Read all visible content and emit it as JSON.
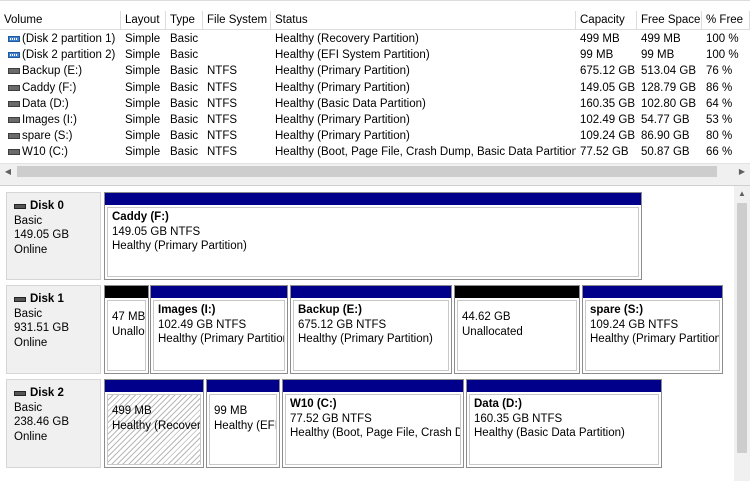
{
  "volume_list": {
    "columns": [
      "Volume",
      "Layout",
      "Type",
      "File System",
      "Status",
      "Capacity",
      "Free Space",
      "% Free"
    ],
    "rows": [
      {
        "volume": "(Disk 2 partition 1)",
        "layout": "Simple",
        "type": "Basic",
        "fs": "",
        "status": "Healthy (Recovery Partition)",
        "capacity": "499 MB",
        "free": "499 MB",
        "pct": "100 %",
        "icon": "hidden-volume-icon"
      },
      {
        "volume": "(Disk 2 partition 2)",
        "layout": "Simple",
        "type": "Basic",
        "fs": "",
        "status": "Healthy (EFI System Partition)",
        "capacity": "99 MB",
        "free": "99 MB",
        "pct": "100 %",
        "icon": "hidden-volume-icon"
      },
      {
        "volume": "Backup (E:)",
        "layout": "Simple",
        "type": "Basic",
        "fs": "NTFS",
        "status": "Healthy (Primary Partition)",
        "capacity": "675.12 GB",
        "free": "513.04 GB",
        "pct": "76 %",
        "icon": "volume-icon"
      },
      {
        "volume": "Caddy (F:)",
        "layout": "Simple",
        "type": "Basic",
        "fs": "NTFS",
        "status": "Healthy (Primary Partition)",
        "capacity": "149.05 GB",
        "free": "128.79 GB",
        "pct": "86 %",
        "icon": "volume-icon"
      },
      {
        "volume": "Data (D:)",
        "layout": "Simple",
        "type": "Basic",
        "fs": "NTFS",
        "status": "Healthy (Basic Data Partition)",
        "capacity": "160.35 GB",
        "free": "102.80 GB",
        "pct": "64 %",
        "icon": "volume-icon"
      },
      {
        "volume": "Images (I:)",
        "layout": "Simple",
        "type": "Basic",
        "fs": "NTFS",
        "status": "Healthy (Primary Partition)",
        "capacity": "102.49 GB",
        "free": "54.77 GB",
        "pct": "53 %",
        "icon": "volume-icon"
      },
      {
        "volume": "spare (S:)",
        "layout": "Simple",
        "type": "Basic",
        "fs": "NTFS",
        "status": "Healthy (Primary Partition)",
        "capacity": "109.24 GB",
        "free": "86.90 GB",
        "pct": "80 %",
        "icon": "volume-icon"
      },
      {
        "volume": "W10 (C:)",
        "layout": "Simple",
        "type": "Basic",
        "fs": "NTFS",
        "status": "Healthy (Boot, Page File, Crash Dump, Basic Data Partition)",
        "capacity": "77.52 GB",
        "free": "50.87 GB",
        "pct": "66 %",
        "icon": "volume-icon"
      }
    ]
  },
  "scroll": {
    "left_arrow": "◀",
    "right_arrow": "▶",
    "up_arrow": "▲"
  },
  "disks": [
    {
      "name": "Disk 0",
      "type": "Basic",
      "size": "149.05 GB",
      "state": "Online",
      "partitions": [
        {
          "name": "Caddy  (F:)",
          "size": "149.05 GB NTFS",
          "status": "Healthy (Primary Partition)",
          "bar": "primary"
        }
      ]
    },
    {
      "name": "Disk 1",
      "type": "Basic",
      "size": "931.51 GB",
      "state": "Online",
      "partitions": [
        {
          "name": "",
          "size": "47 MB",
          "status": "Unallocated",
          "bar": "unallocated"
        },
        {
          "name": "Images  (I:)",
          "size": "102.49 GB NTFS",
          "status": "Healthy (Primary Partition)",
          "bar": "primary"
        },
        {
          "name": "Backup  (E:)",
          "size": "675.12 GB NTFS",
          "status": "Healthy (Primary Partition)",
          "bar": "primary"
        },
        {
          "name": "",
          "size": "44.62 GB",
          "status": "Unallocated",
          "bar": "unallocated"
        },
        {
          "name": "spare  (S:)",
          "size": "109.24 GB NTFS",
          "status": "Healthy (Primary Partition)",
          "bar": "primary"
        }
      ]
    },
    {
      "name": "Disk 2",
      "type": "Basic",
      "size": "238.46 GB",
      "state": "Online",
      "partitions": [
        {
          "name": "",
          "size": "499 MB",
          "status": "Healthy (Recovery Partition)",
          "bar": "primary",
          "selected": true
        },
        {
          "name": "",
          "size": "99 MB",
          "status": "Healthy (EFI System Partition)",
          "bar": "primary"
        },
        {
          "name": "W10  (C:)",
          "size": "77.52 GB NTFS",
          "status": "Healthy (Boot, Page File, Crash Dump, Basic Data Partition)",
          "bar": "primary"
        },
        {
          "name": "Data  (D:)",
          "size": "160.35 GB NTFS",
          "status": "Healthy (Basic Data Partition)",
          "bar": "primary"
        }
      ]
    }
  ],
  "colors": {
    "primary_bar": "#00008b",
    "unallocated_bar": "#000000"
  }
}
